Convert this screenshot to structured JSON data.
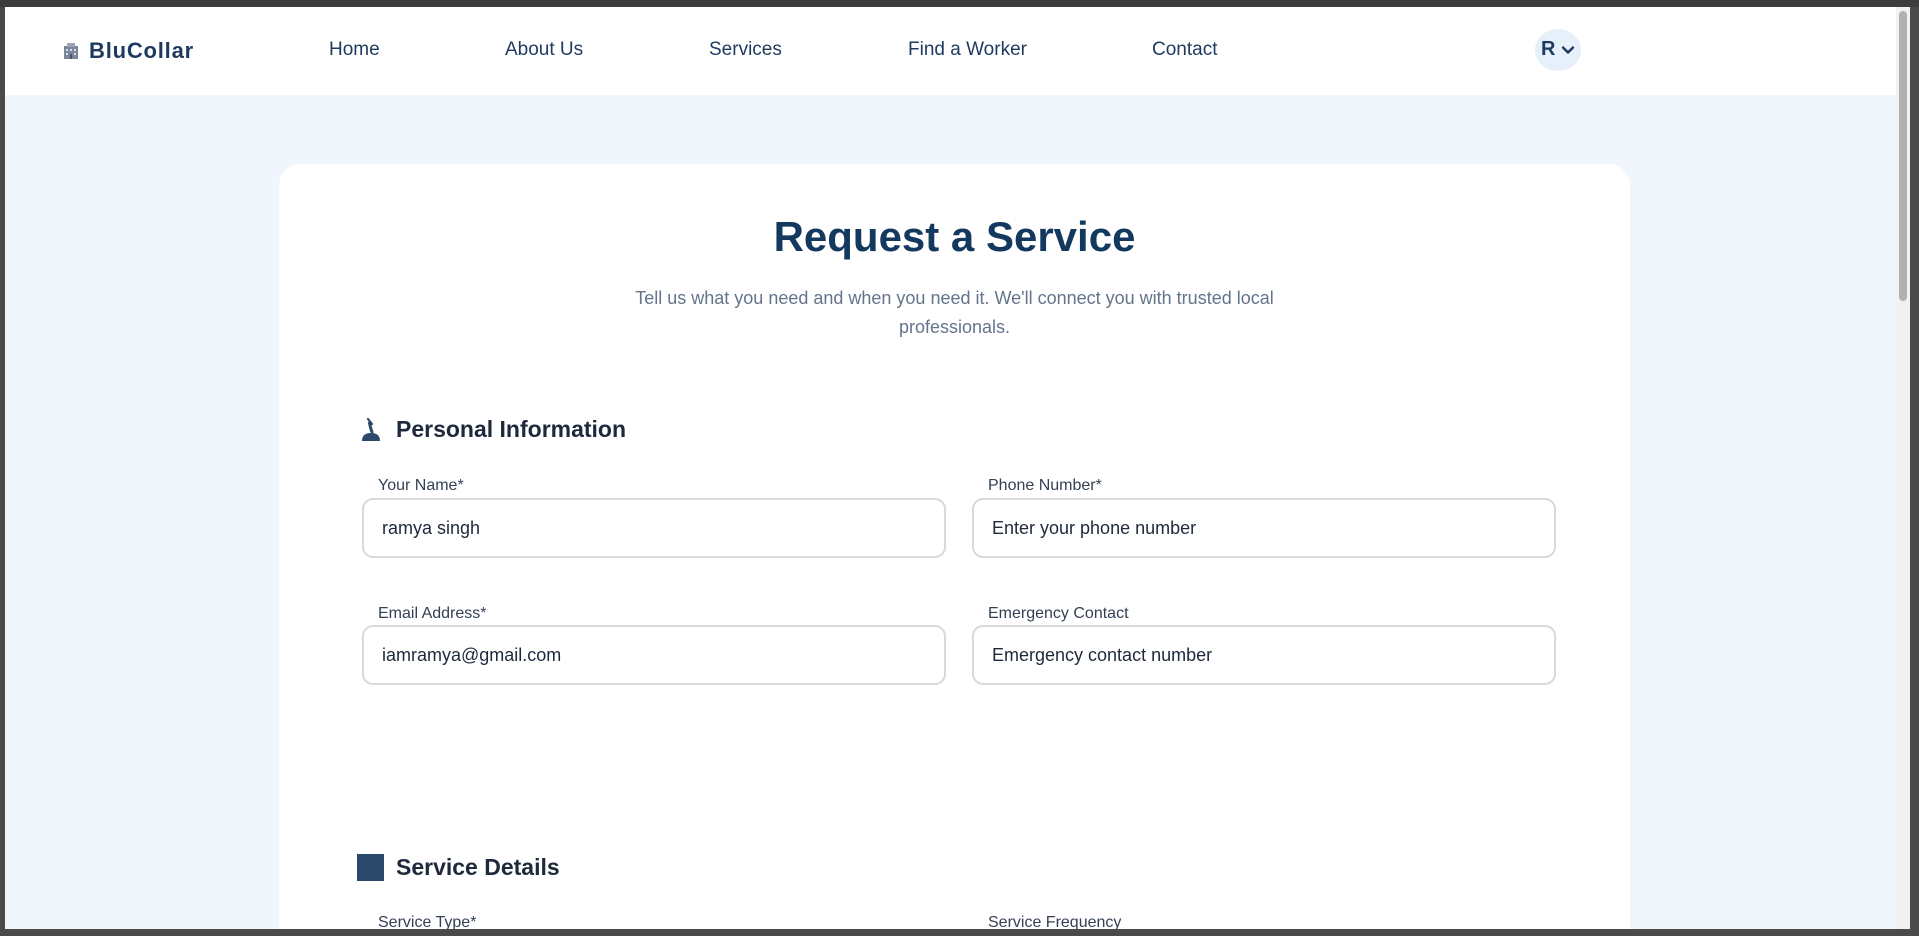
{
  "nav": {
    "brand": "BluCollar",
    "links": [
      "Home",
      "About Us",
      "Services",
      "Find a Worker",
      "Contact"
    ],
    "avatar_initial": "R"
  },
  "page": {
    "title": "Request a Service",
    "subtitle": "Tell us what you need and when you need it. We'll connect you with trusted local professionals."
  },
  "personal": {
    "title": "Personal Information",
    "name_label": "Your Name*",
    "name_value": "ramya singh",
    "phone_label": "Phone Number*",
    "phone_placeholder": "Enter your phone number",
    "email_label": "Email Address*",
    "email_value": "iamramya@gmail.com",
    "emergency_label": "Emergency Contact",
    "emergency_placeholder": "Emergency contact number"
  },
  "service": {
    "title": "Service Details",
    "type_label": "Service Type*",
    "frequency_label": "Service Frequency"
  },
  "colors": {
    "primary": "#1e3a5f",
    "page_bg": "#f1f6fd",
    "section_square": "#2b4a6b"
  },
  "icons": {
    "brand": "building-icon",
    "personal": "person-icon",
    "service": "square-icon",
    "avatar_menu": "chevron-down-icon"
  }
}
